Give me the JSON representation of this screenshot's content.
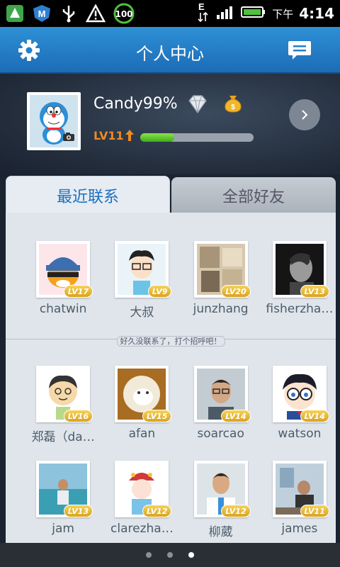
{
  "status_bar": {
    "battery": "100",
    "time": "4:14",
    "ampm": "下午",
    "icons": [
      "sprite-icon",
      "maxthon-icon",
      "usb-icon",
      "warning-icon",
      "battery-100-icon",
      "data-transfer-icon",
      "signal-icon",
      "battery-icon"
    ]
  },
  "header": {
    "title": "个人中心",
    "left_icon": "gear-icon",
    "right_icon": "chat-icon"
  },
  "profile": {
    "username": "Candy99%",
    "level": "LV11",
    "xp_fraction": 0.3,
    "accent_color": "#ef8a22"
  },
  "tabs": [
    {
      "label": "最近联系",
      "active": true
    },
    {
      "label": "全部好友",
      "active": false
    }
  ],
  "recent": [
    {
      "name": "chatwin",
      "level": "LV17"
    },
    {
      "name": "大叔",
      "level": "LV9"
    },
    {
      "name": "junzhang",
      "level": "LV20"
    },
    {
      "name": "fisherzha…",
      "level": "LV13"
    }
  ],
  "divider_text": "好久没联系了，打个招呼吧！",
  "friends": [
    {
      "name": "郑磊（da…",
      "level": "LV16"
    },
    {
      "name": "afan",
      "level": "LV15"
    },
    {
      "name": "soarcao",
      "level": "LV14"
    },
    {
      "name": "watson",
      "level": "LV14"
    },
    {
      "name": "jam",
      "level": "LV13"
    },
    {
      "name": "clarezha…",
      "level": "LV12"
    },
    {
      "name": "柳葳",
      "level": "LV12"
    },
    {
      "name": "james",
      "level": "LV11"
    }
  ],
  "pager": {
    "pages": 3,
    "current": 3
  }
}
